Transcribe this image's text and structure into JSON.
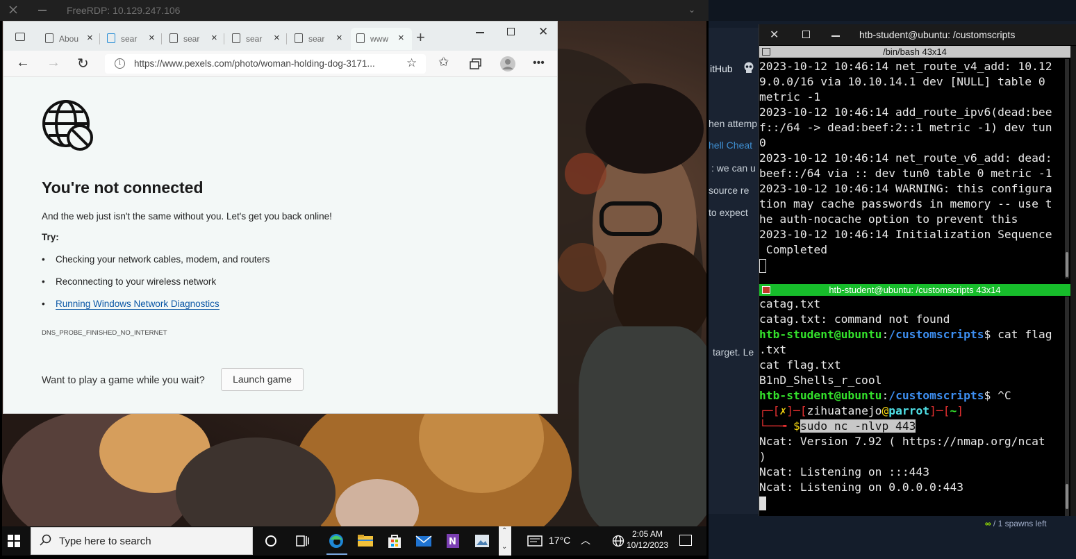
{
  "rdp": {
    "title": "FreeRDP: 10.129.247.106"
  },
  "edge": {
    "tabs": [
      {
        "label": "Abou"
      },
      {
        "label": "sear"
      },
      {
        "label": "sear"
      },
      {
        "label": "sear"
      },
      {
        "label": "sear"
      },
      {
        "label": "www"
      }
    ],
    "address": "https://www.pexels.com/photo/woman-holding-dog-3171...",
    "error": {
      "title": "You're not connected",
      "subtitle": "And the web just isn't the same without you. Let's get you back online!",
      "try_label": "Try:",
      "items": [
        "Checking your network cables, modem, and routers",
        "Reconnecting to your wireless network",
        "Running Windows Network Diagnostics"
      ],
      "code": "DNS_PROBE_FINISHED_NO_INTERNET",
      "game_question": "Want to play a game while you wait?",
      "game_button": "Launch game"
    }
  },
  "taskbar": {
    "search_placeholder": "Type here to search",
    "weather": "17°C",
    "time": "2:05 AM",
    "date": "10/12/2023"
  },
  "background": {
    "github": "itHub",
    "snippet1": "hen attemp",
    "snippet2": "hell Cheat",
    "snippet3": ": we can u",
    "snippet4": "source re",
    "snippet5": "to expect",
    "snippet6": "target. Le",
    "spawns": "/ 1 spawns left",
    "spawns_icon": "∞"
  },
  "terminal": {
    "window_title": "htb-student@ubuntu: /customscripts",
    "pane1_title": "/bin/bash 43x14",
    "pane2_title": "htb-student@ubuntu: /customscripts 43x14",
    "pane1_lines": [
      "2023-10-12 10:46:14 net_route_v4_add: 10.12",
      "9.0.0/16 via 10.10.14.1 dev [NULL] table 0",
      "metric -1",
      "2023-10-12 10:46:14 add_route_ipv6(dead:bee",
      "f::/64 -> dead:beef:2::1 metric -1) dev tun",
      "0",
      "2023-10-12 10:46:14 net_route_v6_add: dead:",
      "beef::/64 via :: dev tun0 table 0 metric -1",
      "2023-10-12 10:46:14 WARNING: this configura",
      "tion may cache passwords in memory -- use t",
      "he auth-nocache option to prevent this",
      "2023-10-12 10:46:14 Initialization Sequence",
      " Completed"
    ],
    "pane2": {
      "l1": "catag.txt",
      "l2": "catag.txt: command not found",
      "user": "htb-student@ubuntu",
      "colon": ":",
      "path": "/customscripts",
      "cmd1": "$ cat flag",
      "l4": ".txt",
      "l5": "cat flag.txt",
      "l6": "B1nD_Shells_r_cool",
      "cmd2": "$ ^C",
      "p_open": "┌─[",
      "p_x": "✗",
      "p_mid": "]─[",
      "p_user": "zihuatanejo",
      "p_at": "@",
      "p_host": "parrot",
      "p_mid2": "]─[",
      "p_dir": "~",
      "p_close": "]",
      "p_arrow": "└──╼ ",
      "p_dollar": "$",
      "cmd3": "sudo nc -nlvp 443",
      "l9": "Ncat: Version 7.92 ( https://nmap.org/ncat",
      "l10": ")",
      "l11": "Ncat: Listening on :::443",
      "l12": "Ncat: Listening on 0.0.0.0:443"
    }
  }
}
